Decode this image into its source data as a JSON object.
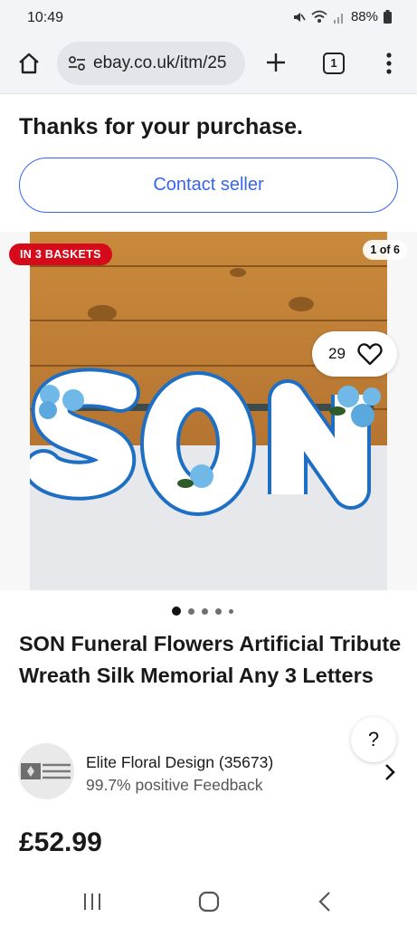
{
  "status_bar": {
    "time": "10:49",
    "battery": "88%",
    "icons": [
      "mute-icon",
      "wifi-icon",
      "signal-icon",
      "battery-icon"
    ]
  },
  "browser": {
    "url": "ebay.co.uk/itm/25",
    "tab_count": "1",
    "icons": [
      "home-icon",
      "site-settings-icon",
      "new-tab-icon",
      "tabs-icon",
      "more-icon"
    ]
  },
  "page": {
    "thanks_heading": "Thanks for your purchase.",
    "contact_seller_label": "Contact seller"
  },
  "gallery": {
    "baskets_badge": "IN 3 BASKETS",
    "image_counter": "1 of 6",
    "watch_count": "29",
    "current_index": 1,
    "dot_count": 5,
    "colors": {
      "badge": "#d50b1b",
      "accent": "#3665f3"
    }
  },
  "listing": {
    "title": "SON Funeral Flowers Artificial Tribute Wreath Silk Memorial Any 3 Letters",
    "help_label": "?",
    "price": "£52.99"
  },
  "seller": {
    "name": "Elite Floral Design (35673)",
    "feedback": "99.7% positive Feedback",
    "logo_text": "ELITE FLORAL DESIGN"
  },
  "nav_bar": {
    "icons": [
      "recents-icon",
      "home-circle-icon",
      "back-icon"
    ]
  }
}
